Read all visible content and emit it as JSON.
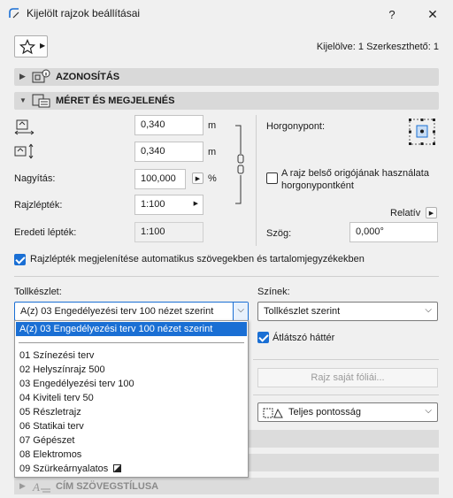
{
  "window": {
    "title": "Kijelölt rajzok beállításai",
    "help_label": "?",
    "close_label": "✕"
  },
  "toolbar": {
    "selection_info": "Kijelölve: 1 Szerkeszthető: 1"
  },
  "panels": {
    "id_title": "AZONOSÍTÁS",
    "size_title": "MÉRET ÉS MEGJELENÉS",
    "text_style_title": "CÍM SZÖVEGSTÍLUSA"
  },
  "size": {
    "width_value": "0,340",
    "width_unit": "m",
    "height_value": "0,340",
    "height_unit": "m",
    "zoom_label": "Nagyítás:",
    "zoom_value": "100,000",
    "zoom_unit": "%",
    "scale_label": "Rajzlépték:",
    "scale_value": "1:100",
    "orig_scale_label": "Eredeti lépték:",
    "orig_scale_value": "1:100",
    "anchor_label": "Horgonypont:",
    "origin_checkbox_label_1": "A rajz belső origójának használata",
    "origin_checkbox_label_2": "horgonypontként",
    "relative_label": "Relatív",
    "angle_label": "Szög:",
    "angle_value": "0,000°",
    "auto_scale_label": "Rajzlépték megjelenítése automatikus szövegekben és tartalomjegyzékekben"
  },
  "pens": {
    "penset_label": "Tollkészlet:",
    "penset_selected": "A(z) 03 Engedélyezési terv 100 nézet szerint",
    "colors_label": "Színek:",
    "colors_selected": "Tollkészlet szerint",
    "transparent_label": "Átlátszó háttér",
    "layers_button": "Rajz saját fóliái...",
    "precision_selected": "Teljes pontosság"
  },
  "penset_options": [
    "A(z) 03 Engedélyezési terv 100 nézet szerint",
    "01 Színezési terv",
    "02 Helyszínrajz 500",
    "03 Engedélyezési terv 100",
    "04 Kiviteli terv 50",
    "05 Részletrajz",
    "06 Statikai terv",
    "07 Gépészet",
    "08 Elektromos",
    "09 Szürkeárnyalatos"
  ],
  "colors": {
    "accent": "#1a6fd4",
    "panel_header": "#d9d9d9",
    "background": "#f0f0f0"
  },
  "icons": {
    "app": "archicad-drawing-icon",
    "favorites": "star-icon",
    "anchor": "anchor-point-grid-icon",
    "lock": "chain-link-icon"
  }
}
